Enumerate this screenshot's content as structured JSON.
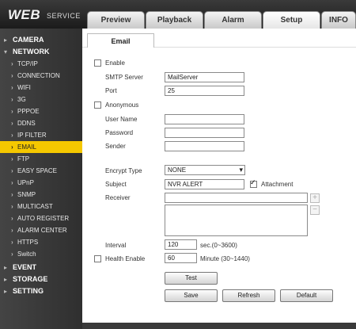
{
  "header": {
    "logo_main": "WEB",
    "logo_sub": "SERVICE",
    "tabs": [
      "Preview",
      "Playback",
      "Alarm",
      "Setup",
      "INFO"
    ]
  },
  "sidebar": {
    "camera": "CAMERA",
    "network": "NETWORK",
    "items": [
      "TCP/IP",
      "CONNECTION",
      "WIFI",
      "3G",
      "PPPOE",
      "DDNS",
      "IP FILTER",
      "EMAIL",
      "FTP",
      "EASY SPACE",
      "UPnP",
      "SNMP",
      "MULTICAST",
      "AUTO REGISTER",
      "ALARM CENTER",
      "HTTPS",
      "Switch"
    ],
    "event": "EVENT",
    "storage": "STORAGE",
    "setting": "SETTING"
  },
  "email": {
    "tab_title": "Email",
    "enable_label": "Enable",
    "smtp_label": "SMTP Server",
    "smtp_value": "MailServer",
    "port_label": "Port",
    "port_value": "25",
    "anonymous_label": "Anonymous",
    "username_label": "User Name",
    "username_value": "",
    "password_label": "Password",
    "password_value": "",
    "sender_label": "Sender",
    "sender_value": "",
    "encrypt_label": "Encrypt Type",
    "encrypt_value": "NONE",
    "subject_label": "Subject",
    "subject_value": "NVR ALERT",
    "attachment_label": "Attachment",
    "receiver_label": "Receiver",
    "interval_label": "Interval",
    "interval_value": "120",
    "interval_hint": "sec.(0~3600)",
    "health_label": "Health Enable",
    "health_value": "60",
    "health_hint": "Minute (30~1440)",
    "test_label": "Test",
    "save_label": "Save",
    "refresh_label": "Refresh",
    "default_label": "Default"
  },
  "icons": {
    "plus": "plus-icon",
    "minus": "minus-icon",
    "chevron": "chevron-down-icon",
    "arrow": "chevron-right-icon"
  },
  "colors": {
    "header_bg": "#2a2a2a",
    "sidebar_bg": "#3a3a3a",
    "active_item": "#f5c800"
  }
}
